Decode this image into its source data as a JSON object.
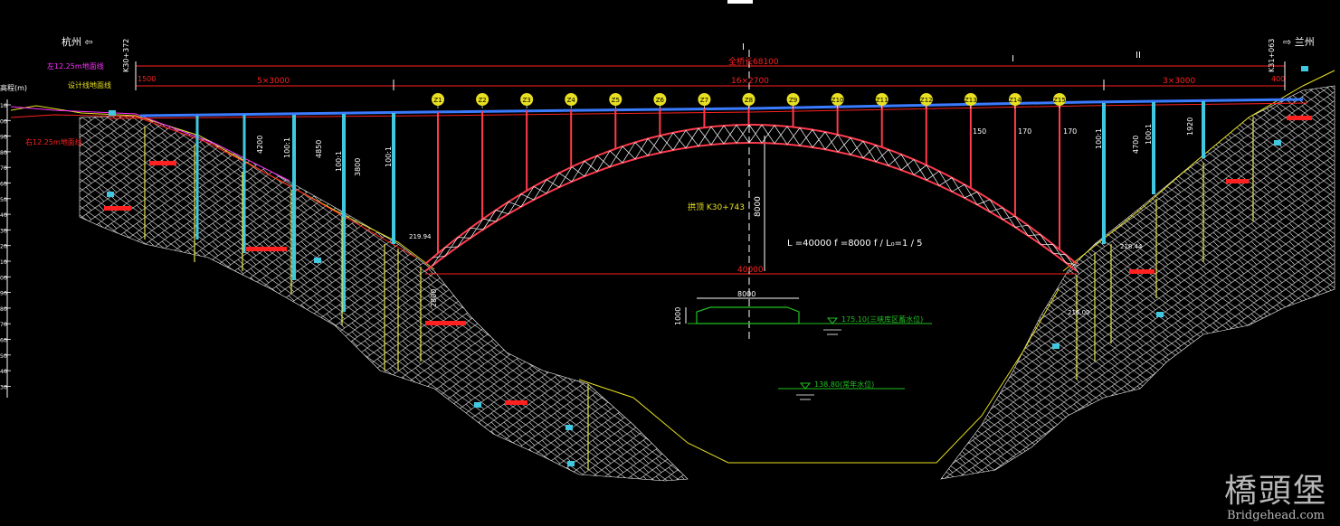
{
  "labels": {
    "left_end": "杭州 ⇦",
    "right_end": "⇨ 兰州",
    "elev_axis": "高程(m)",
    "left_station": "K30+372",
    "right_station": "K31+063",
    "total_length": "全桥长68100",
    "left_span_dim": "5×3000",
    "main_span_dim": "16×2700",
    "right_span_dim": "3×3000",
    "left_first_dim": "1500",
    "right_last_dim": "400",
    "section_1": "I",
    "section_2": "II",
    "center_station": "拱顶 K30+743",
    "arch_params": "L =40000  f =8000  f / L₀=1 / 5",
    "span_40000": "40000",
    "rise_8000": "8000",
    "nav_width": "8000",
    "nav_height": "1000",
    "water_high": "175.10(三峡库区蓄水位)",
    "water_low": "138.80(常年水位)",
    "legend_design": "设计线地面线",
    "legend_a": "左12.25m地面线",
    "legend_b": "右12.25m地面线",
    "dim_150": "150",
    "dim_170a": "170",
    "dim_170b": "170",
    "dim_4200": "4200",
    "dim_4850": "4850",
    "dim_1920": "1920",
    "dim_1001_l1": "100:1",
    "dim_1001_l2": "100:1",
    "dim_1001_l3": "100:1",
    "dim_1001_r1": "100:1",
    "dim_1001_r2": "100:1",
    "dim_3800": "3800",
    "dim_4700": "4700",
    "dim_2800": "2800",
    "elev_2184": "218.44",
    "elev_2199": "219.94",
    "elev_2160": "216.00"
  },
  "elev_ticks": [
    "10",
    "00",
    "90",
    "80",
    "70",
    "60",
    "50",
    "40",
    "30",
    "20",
    "10",
    "00",
    "90",
    "80",
    "70",
    "60",
    "50",
    "40",
    "30"
  ],
  "column_numbers": [
    "Z1",
    "Z2",
    "Z3",
    "Z4",
    "Z5",
    "Z6",
    "Z7",
    "Z8",
    "Z9",
    "Z10",
    "Z11",
    "Z12",
    "Z13",
    "Z14",
    "Z15"
  ],
  "watermark": {
    "cn": "橋頭堡",
    "en": "Bridgehead.com"
  },
  "colors": {
    "deck": "#3a7bff",
    "arch": "#ff3b4d",
    "truss": "#ffffff",
    "pier": "#3fc8e0",
    "dim": "#ff2020",
    "ground": "#e8e020",
    "rock": "#ffffff",
    "pile": "#e6e64a",
    "water": "#20c020",
    "magenta": "#ff30ff"
  }
}
